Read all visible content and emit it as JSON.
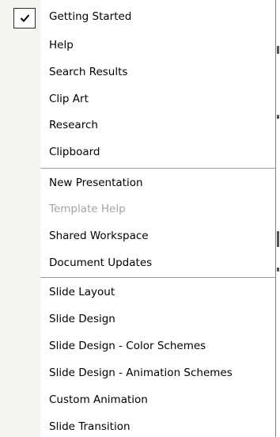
{
  "menu": {
    "items": [
      {
        "label": "Getting Started",
        "checked": true,
        "enabled": true
      },
      {
        "label": "Help",
        "checked": false,
        "enabled": true
      },
      {
        "label": "Search Results",
        "checked": false,
        "enabled": true
      },
      {
        "label": "Clip Art",
        "checked": false,
        "enabled": true
      },
      {
        "label": "Research",
        "checked": false,
        "enabled": true
      },
      {
        "label": "Clipboard",
        "checked": false,
        "enabled": true
      },
      {
        "label": "New Presentation",
        "checked": false,
        "enabled": true
      },
      {
        "label": "Template Help",
        "checked": false,
        "enabled": false
      },
      {
        "label": "Shared Workspace",
        "checked": false,
        "enabled": true
      },
      {
        "label": "Document Updates",
        "checked": false,
        "enabled": true
      },
      {
        "label": "Slide Layout",
        "checked": false,
        "enabled": true
      },
      {
        "label": "Slide Design",
        "checked": false,
        "enabled": true
      },
      {
        "label": "Slide Design - Color Schemes",
        "checked": false,
        "enabled": true
      },
      {
        "label": "Slide Design - Animation Schemes",
        "checked": false,
        "enabled": true
      },
      {
        "label": "Custom Animation",
        "checked": false,
        "enabled": true
      },
      {
        "label": "Slide Transition",
        "checked": false,
        "enabled": true
      }
    ]
  },
  "colors": {
    "text": "#000000",
    "disabled_text": "#a3a3a3",
    "gutter": "#f5f4ef",
    "separator": "#9d9d9d",
    "border": "#808080"
  },
  "icons": {
    "check": "checkmark-icon"
  }
}
